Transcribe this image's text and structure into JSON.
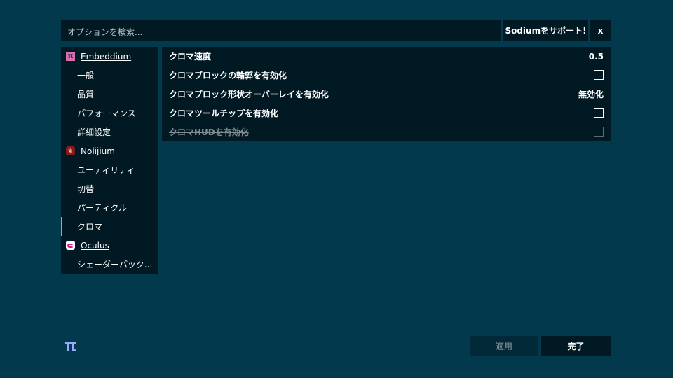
{
  "colors": {
    "background": "#03394d",
    "panel": "#0b1a20",
    "accent_selected": "#c28fd6",
    "logo": "#9ba8ff",
    "disabled_text": "#7f8c92"
  },
  "search": {
    "placeholder": "オプションを検索..."
  },
  "header": {
    "support_label": "Sodiumをサポート!",
    "close_label": "x"
  },
  "sidebar": {
    "mods": [
      {
        "name": "Embeddium",
        "icon": "pi-icon",
        "pages": [
          "一般",
          "品質",
          "パフォーマンス",
          "詳細設定"
        ]
      },
      {
        "name": "Nolijium",
        "icon": "nolijium-icon",
        "pages": [
          "ユーティリティ",
          "切替",
          "パーティクル",
          "クロマ"
        ]
      },
      {
        "name": "Oculus",
        "icon": "oculus-icon",
        "pages": [
          "シェーダーパック..."
        ]
      }
    ],
    "selected_page": "クロマ"
  },
  "options": [
    {
      "label": "クロマ速度",
      "type": "value",
      "value": "0.5",
      "enabled": true
    },
    {
      "label": "クロマブロックの輪郭を有効化",
      "type": "checkbox",
      "checked": false,
      "enabled": true
    },
    {
      "label": "クロマブロック形状オーバーレイを有効化",
      "type": "value",
      "value": "無効化",
      "enabled": true
    },
    {
      "label": "クロマツールチップを有効化",
      "type": "checkbox",
      "checked": false,
      "enabled": true
    },
    {
      "label": "クロマHUDを有効化",
      "type": "checkbox",
      "checked": false,
      "enabled": false
    }
  ],
  "footer": {
    "logo_icon": "pi-logo-icon",
    "apply_label": "適用",
    "apply_enabled": false,
    "done_label": "完了"
  }
}
